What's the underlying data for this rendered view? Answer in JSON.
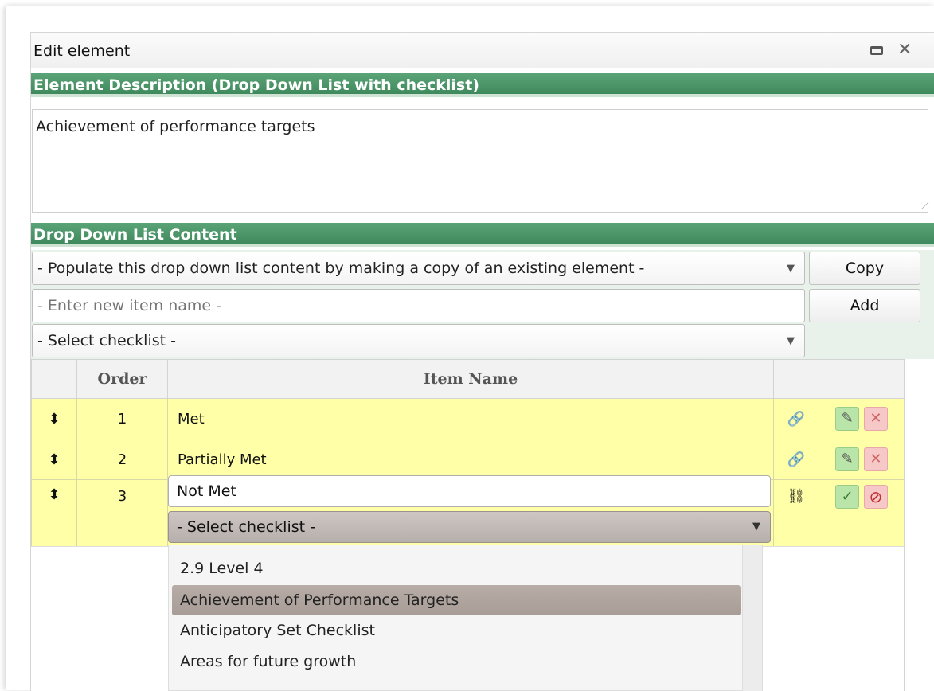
{
  "dialog": {
    "title": "Edit element"
  },
  "description_section": {
    "header": "Element Description (Drop Down List with checklist)",
    "text": "Achievement of performance targets"
  },
  "content_section": {
    "header": "Drop Down List Content",
    "copy_select": "- Populate this drop down list content by making a copy of an existing element -",
    "copy_button": "Copy",
    "new_item_placeholder": "- Enter new item name -",
    "add_button": "Add",
    "checklist_select": "- Select checklist -"
  },
  "table": {
    "columns": [
      "",
      "Order",
      "Item Name",
      "",
      ""
    ],
    "rows": [
      {
        "order": "1",
        "name": "Met"
      },
      {
        "order": "2",
        "name": "Partially Met"
      },
      {
        "order": "3",
        "name": "Not Met"
      }
    ],
    "editing_checklist_select": "- Select checklist -"
  },
  "dropdown": {
    "options": [
      "2.9 Level 4",
      "Achievement of Performance Targets",
      "Anticipatory Set Checklist",
      "Areas for future growth"
    ],
    "selected_index": 1
  },
  "icons": {
    "sort": "sort-icon",
    "link": "link-icon",
    "unlink": "unlink-icon",
    "edit": "pencil-icon",
    "delete": "close-icon",
    "confirm": "check-icon",
    "cancel": "ban-icon"
  },
  "colors": {
    "header_green": "#4e9a6c",
    "row_yellow": "#ffffa8",
    "edit_green": "#b9e6a8",
    "delete_pink": "#f7c8c8"
  }
}
